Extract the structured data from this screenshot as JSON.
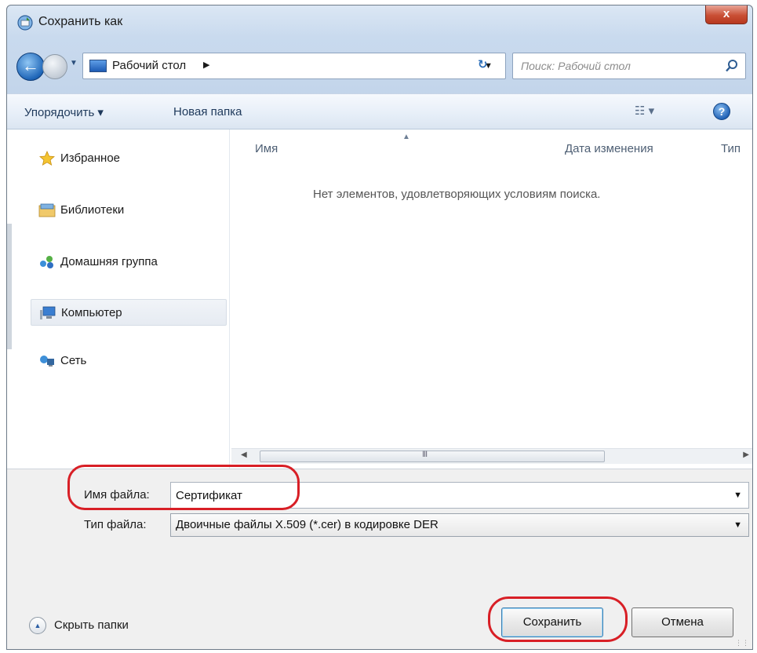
{
  "window": {
    "title": "Сохранить как",
    "close_label": "x"
  },
  "address": {
    "location": "Рабочий стол",
    "search_placeholder": "Поиск: Рабочий стол"
  },
  "toolbar": {
    "organize_label": "Упорядочить ▾",
    "new_folder_label": "Новая папка",
    "views_label": "☷ ▾",
    "help_label": "?"
  },
  "navigation": {
    "items": [
      {
        "label": "Избранное",
        "icon": "star-icon"
      },
      {
        "label": "Библиотеки",
        "icon": "libraries-icon"
      },
      {
        "label": "Домашняя группа",
        "icon": "homegroup-icon"
      },
      {
        "label": "Компьютер",
        "icon": "computer-icon",
        "selected": true
      },
      {
        "label": "Сеть",
        "icon": "network-icon"
      }
    ]
  },
  "file_list": {
    "columns": [
      "Имя",
      "Дата изменения",
      "Тип"
    ],
    "empty_message": "Нет элементов, удовлетворяющих условиям поиска.",
    "scroll_grip": "III"
  },
  "form": {
    "filename_label": "Имя файла:",
    "filename_value": "Сертификат",
    "filetype_label": "Тип файла:",
    "filetype_value": "Двоичные файлы X.509 (*.cer) в кодировке DER",
    "hide_folders_label": "Скрыть папки",
    "save_label": "Сохранить",
    "cancel_label": "Отмена"
  },
  "colors": {
    "annotation": "#d81f26",
    "accent": "#1f66b8"
  }
}
